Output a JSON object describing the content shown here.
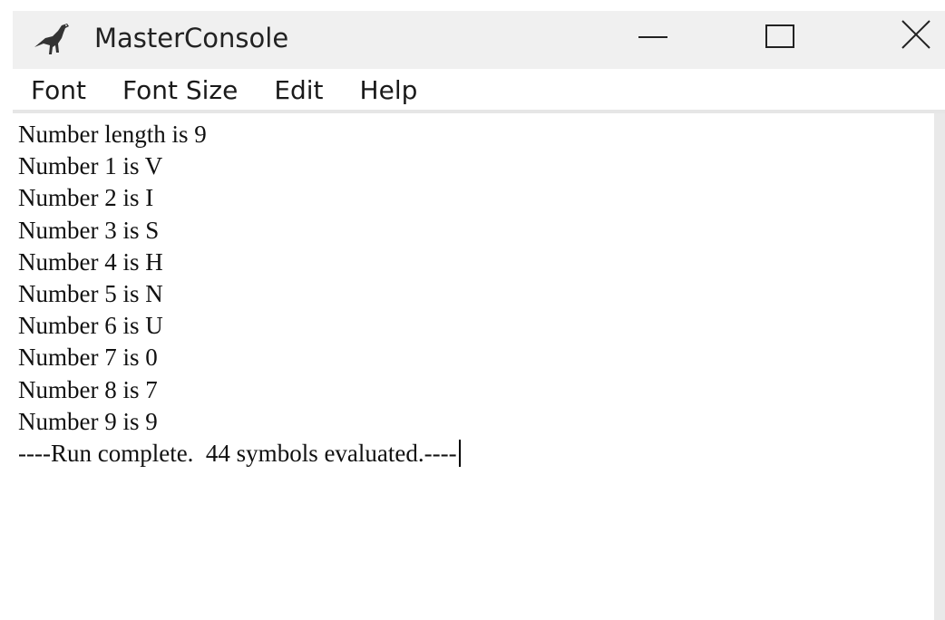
{
  "window": {
    "title": "MasterConsole",
    "app_icon": "dinosaur-icon",
    "controls": {
      "minimize_icon": "minimize-icon",
      "maximize_icon": "maximize-icon",
      "close_icon": "close-icon"
    }
  },
  "menu": {
    "items": [
      {
        "label": "Font"
      },
      {
        "label": "Font Size"
      },
      {
        "label": "Edit"
      },
      {
        "label": "Help"
      }
    ]
  },
  "console": {
    "lines": [
      "Number length is 9",
      "Number 1 is V",
      "Number 2 is I",
      "Number 3 is S",
      "Number 4 is H",
      "Number 5 is N",
      "Number 6 is U",
      "Number 7 is 0",
      "Number 8 is 7",
      "Number 9 is 9",
      "----Run complete.  44 symbols evaluated.----"
    ]
  }
}
